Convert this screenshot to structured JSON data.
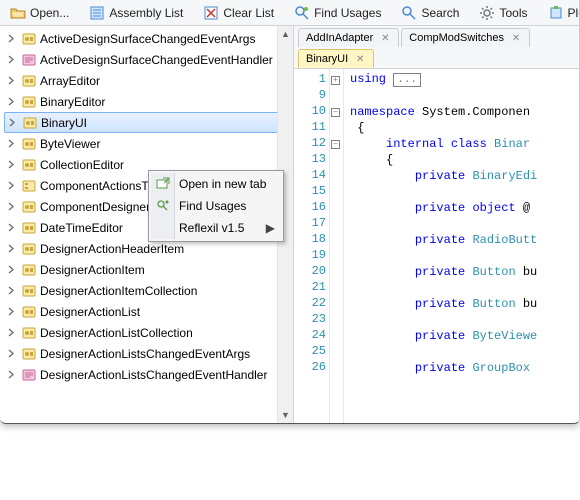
{
  "toolbar": {
    "open": "Open...",
    "assembly_list": "Assembly List",
    "clear_list": "Clear List",
    "find_usages": "Find Usages",
    "search": "Search",
    "tools": "Tools",
    "plugins": "Plugins"
  },
  "tree": {
    "items": [
      {
        "label": "ActiveDesignSurfaceChangedEventArgs",
        "icon": "class-yellow"
      },
      {
        "label": "ActiveDesignSurfaceChangedEventHandler",
        "icon": "delegate-pink"
      },
      {
        "label": "ArrayEditor",
        "icon": "class-yellow"
      },
      {
        "label": "BinaryEditor",
        "icon": "class-yellow"
      },
      {
        "label": "BinaryUI",
        "icon": "class-yellow",
        "selected": true
      },
      {
        "label": "ByteViewer",
        "icon": "class-yellow"
      },
      {
        "label": "CollectionEditor",
        "icon": "class-yellow"
      },
      {
        "label": "ComponentActionsType",
        "icon": "enum-yellow"
      },
      {
        "label": "ComponentDesigner",
        "icon": "class-yellow"
      },
      {
        "label": "DateTimeEditor",
        "icon": "class-yellow"
      },
      {
        "label": "DesignerActionHeaderItem",
        "icon": "class-yellow"
      },
      {
        "label": "DesignerActionItem",
        "icon": "class-yellow"
      },
      {
        "label": "DesignerActionItemCollection",
        "icon": "class-yellow"
      },
      {
        "label": "DesignerActionList",
        "icon": "class-yellow"
      },
      {
        "label": "DesignerActionListCollection",
        "icon": "class-yellow"
      },
      {
        "label": "DesignerActionListsChangedEventArgs",
        "icon": "class-yellow"
      },
      {
        "label": "DesignerActionListsChangedEventHandler",
        "icon": "delegate-pink"
      }
    ]
  },
  "context_menu": {
    "items": [
      {
        "label": "Open in new tab",
        "icon": "open-tab-icon"
      },
      {
        "label": "Find Usages",
        "icon": "find-usages-icon"
      },
      {
        "label": "Reflexil v1.5",
        "submenu": true
      }
    ]
  },
  "tabs": [
    {
      "label": "AddInAdapter",
      "active": false
    },
    {
      "label": "CompModSwitches",
      "active": false
    },
    {
      "label": "BinaryUI",
      "active": true
    }
  ],
  "code": {
    "lines": [
      {
        "n": 1,
        "fold": "plus",
        "html": "<span class='kw'>using</span> <span class='box-collapsed'>...</span>"
      },
      {
        "n": 9,
        "html": ""
      },
      {
        "n": 10,
        "fold": "minus",
        "html": "<span class='kw'>namespace</span> <span class='id'>System.Componen</span>"
      },
      {
        "n": 11,
        "html": " <span class='pu'>{</span>"
      },
      {
        "n": 12,
        "fold": "minus",
        "html": "     <span class='kw'>internal</span> <span class='kw'>class</span> <span class='tn'>Binar</span>"
      },
      {
        "n": 13,
        "html": "     <span class='pu'>{</span>"
      },
      {
        "n": 14,
        "html": "         <span class='kw'>private</span> <span class='tn'>BinaryEdi</span>"
      },
      {
        "n": 15,
        "html": ""
      },
      {
        "n": 16,
        "html": "         <span class='kw'>private</span> <span class='kw'>object</span> <span class='id'>@</span>"
      },
      {
        "n": 17,
        "html": ""
      },
      {
        "n": 18,
        "html": "         <span class='kw'>private</span> <span class='tn'>RadioButt</span>"
      },
      {
        "n": 19,
        "html": ""
      },
      {
        "n": 20,
        "html": "         <span class='kw'>private</span> <span class='tn'>Button</span> <span class='id'>bu</span>"
      },
      {
        "n": 21,
        "html": ""
      },
      {
        "n": 22,
        "html": "         <span class='kw'>private</span> <span class='tn'>Button</span> <span class='id'>bu</span>"
      },
      {
        "n": 23,
        "html": ""
      },
      {
        "n": 24,
        "html": "         <span class='kw'>private</span> <span class='tn'>ByteViewe</span>"
      },
      {
        "n": 25,
        "html": ""
      },
      {
        "n": 26,
        "html": "         <span class='kw'>private</span> <span class='tn'>GroupBox</span> "
      }
    ]
  }
}
